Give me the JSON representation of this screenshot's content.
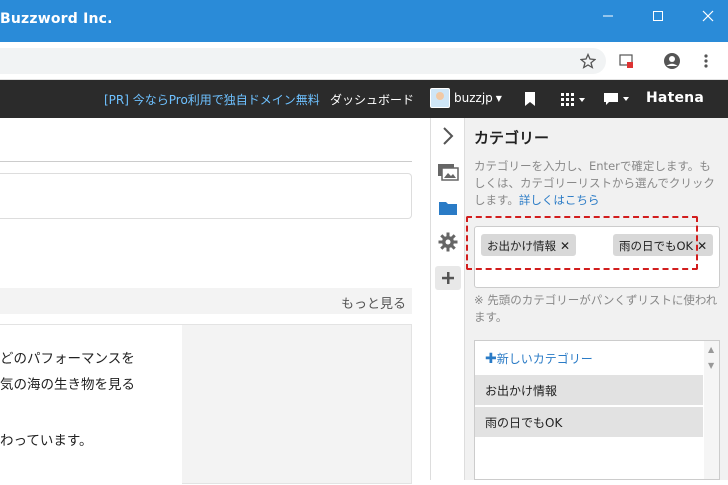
{
  "window": {
    "title": "Buzzword Inc."
  },
  "hatena_bar": {
    "promo": "[PR] 今ならPro利用で独自ドメイン無料",
    "dashboard": "ダッシュボード",
    "username": "buzzjp",
    "logo": "Hatena"
  },
  "main": {
    "more_link": "もっと見る",
    "article_lines": [
      "どのパフォーマンスを",
      "気の海の生き物を見る",
      "わっています。"
    ]
  },
  "panel": {
    "title": "カテゴリー",
    "description": "カテゴリーを入力し、Enterで確定します。もしくは、カテゴリーリストから選んでクリックします。",
    "details_link": "詳しくはこちら",
    "tags": [
      {
        "label": "お出かけ情報"
      },
      {
        "label": "雨の日でもOK"
      }
    ],
    "note": "※ 先頭のカテゴリーがパンくずリストに使われます。",
    "new_category": "新しいカテゴリー",
    "category_list": [
      "お出かけ情報",
      "雨の日でもOK"
    ]
  },
  "icons": {
    "minimize": "minimize-icon",
    "maximize": "maximize-icon",
    "close": "close-icon",
    "star": "star-icon",
    "cast": "cast-icon",
    "account": "account-icon",
    "menu": "menu-icon",
    "bookmark": "bookmark-icon",
    "apps": "apps-icon",
    "comment": "comment-icon",
    "collapse": "chevron-right-icon",
    "image": "image-icon",
    "folder": "folder-icon",
    "gear": "gear-icon",
    "plus": "plus-icon"
  },
  "colors": {
    "titlebar": "#2a8bd8",
    "hatena_bar": "#2b2b2b",
    "link": "#2a7bc6",
    "highlight": "#d21d1d"
  }
}
